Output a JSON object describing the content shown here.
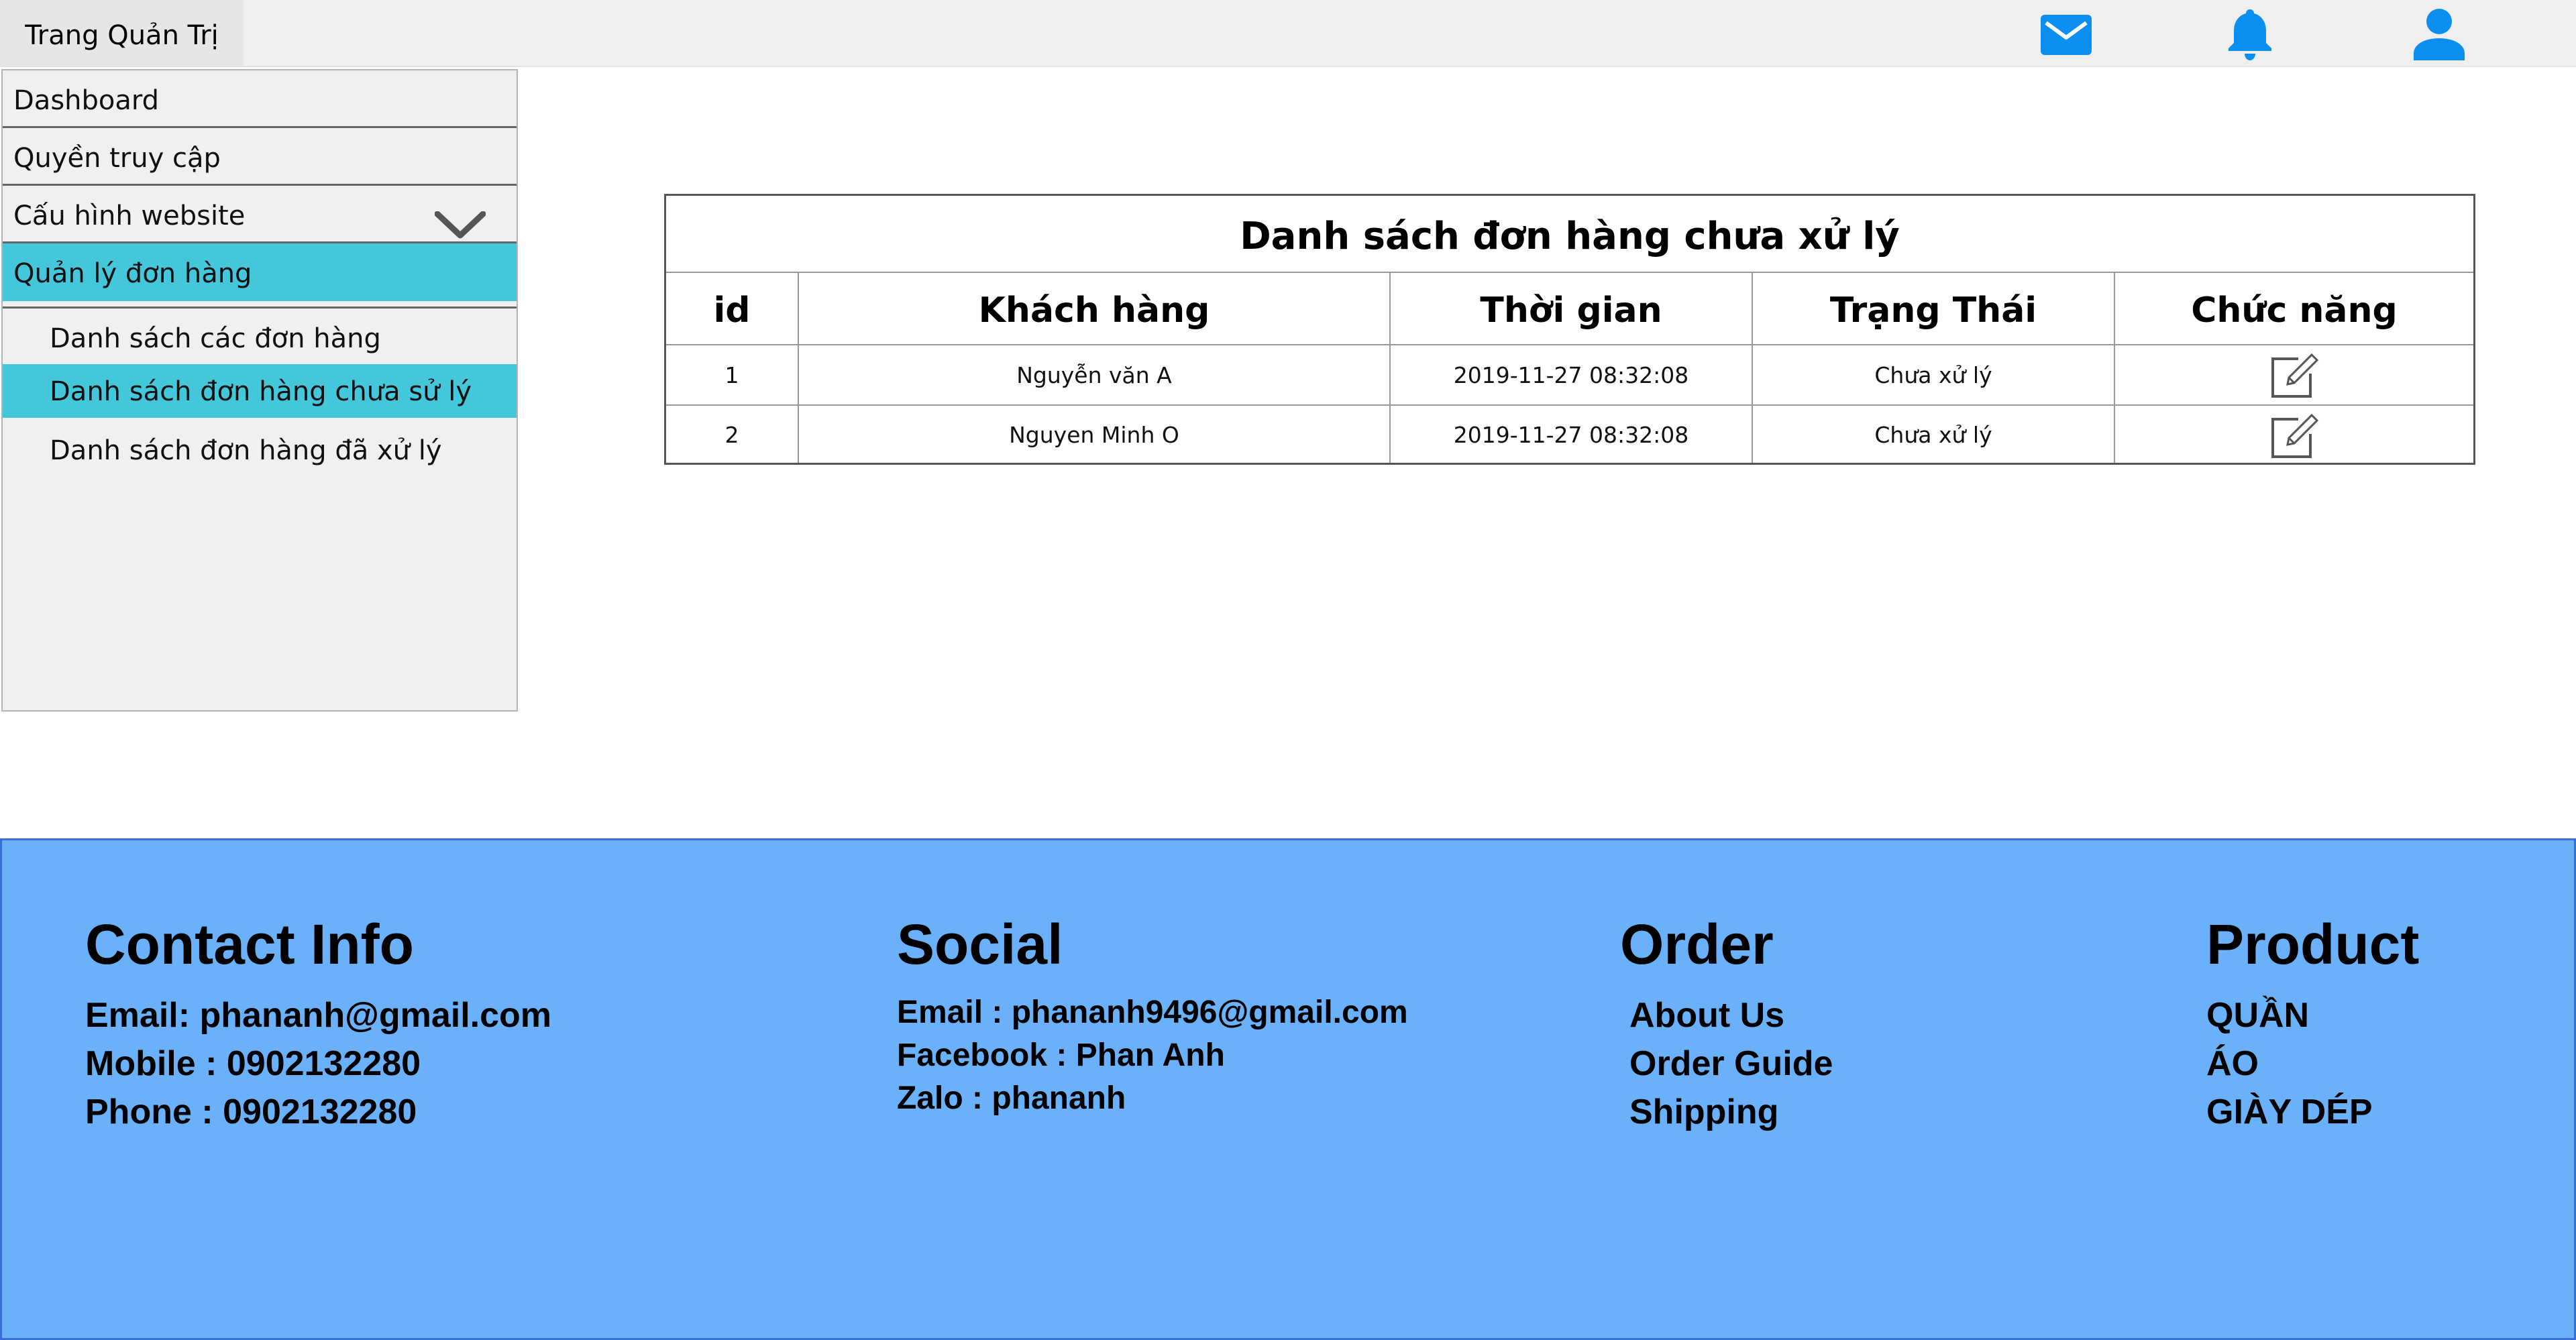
{
  "header": {
    "title": "Trang Quản Trị",
    "icons": [
      "mail-icon",
      "bell-icon",
      "user-icon"
    ],
    "icon_color": "#0a8ef0"
  },
  "sidebar": {
    "items": [
      {
        "label": "Dashboard"
      },
      {
        "label": "Quyền truy cập"
      },
      {
        "label": "Cấu hình website",
        "icon": "chevron-down-icon"
      },
      {
        "label": "Quản lý đơn hàng",
        "active": true
      },
      {
        "label": "Danh sách các đơn hàng"
      },
      {
        "label": "Danh sách đơn hàng chưa sử lý",
        "active": true
      },
      {
        "label": "Danh sách đơn hàng đã xử lý"
      }
    ],
    "active_color": "#45c7db"
  },
  "table": {
    "title": "Danh sách đơn hàng chưa  xử lý",
    "columns": [
      "id",
      "Khách hàng",
      "Thời gian",
      "Trạng Thái",
      "Chức năng"
    ],
    "rows": [
      {
        "id": "1",
        "customer": "Nguyễn văn A",
        "time": "2019-11-27 08:32:08",
        "status": "Chưa xử lý",
        "action_icon": "edit-icon"
      },
      {
        "id": "2",
        "customer": "Nguyen Minh O",
        "time": "2019-11-27 08:32:08",
        "status": "Chưa xử lý",
        "action_icon": "edit-icon"
      }
    ]
  },
  "footer": {
    "background": "#6ab1fa",
    "contact": {
      "heading": "Contact Info",
      "lines": [
        "Email: phananh@gmail.com",
        "Mobile : 0902132280",
        "Phone : 0902132280"
      ]
    },
    "social": {
      "heading": "Social",
      "lines": [
        "Email : phananh9496@gmail.com",
        "Facebook : Phan Anh",
        "Zalo : phananh"
      ]
    },
    "order": {
      "heading": "Order",
      "lines": [
        "About Us",
        "Order Guide",
        "Shipping"
      ]
    },
    "product": {
      "heading": "Product",
      "lines": [
        "QUẦN",
        "ÁO",
        "GIÀY DÉP"
      ]
    }
  }
}
